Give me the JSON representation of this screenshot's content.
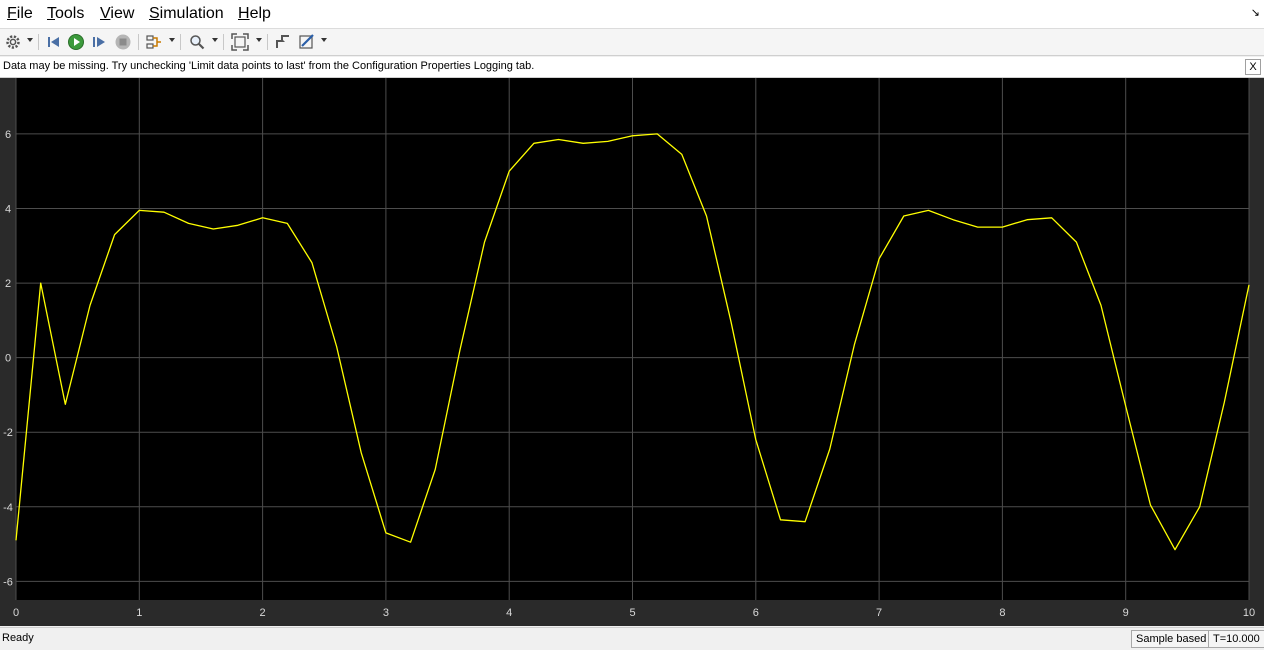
{
  "menu": {
    "items": [
      {
        "underline": "F",
        "rest": "ile"
      },
      {
        "underline": "T",
        "rest": "ools"
      },
      {
        "underline": "V",
        "rest": "iew"
      },
      {
        "underline": "S",
        "rest": "imulation"
      },
      {
        "underline": "H",
        "rest": "elp"
      }
    ],
    "corner_glyph": "↘"
  },
  "toolbar": {
    "icons": [
      "gear-icon",
      "step-back-icon",
      "run-icon",
      "step-forward-icon",
      "stop-icon",
      "signal-selector-icon",
      "zoom-icon",
      "fit-to-view-icon",
      "triggers-icon",
      "style-icon"
    ]
  },
  "info_bar": {
    "message": "Data may be missing.  Try unchecking 'Limit data points to last' from the Configuration Properties Logging tab.",
    "close_label": "X"
  },
  "status": {
    "ready": "Ready",
    "sample_mode": "Sample based",
    "time": "T=10.000"
  },
  "colors": {
    "plot_background": "#000000",
    "axes_background": "#2a2a2a",
    "trace": "#ffff00",
    "grid": "#4d4d4d",
    "tick_text": "#d9d9d9"
  },
  "chart_data": {
    "type": "line",
    "xlim": [
      0,
      10
    ],
    "ylim": [
      -6.5,
      7.5
    ],
    "xticks": [
      0,
      1,
      2,
      3,
      4,
      5,
      6,
      7,
      8,
      9,
      10
    ],
    "yticks": [
      -6,
      -4,
      -2,
      0,
      2,
      4,
      6
    ],
    "grid": true,
    "series": [
      {
        "x": [
          0,
          0.2,
          0.4,
          0.6,
          0.8,
          1.0,
          1.2,
          1.4,
          1.6,
          1.8,
          2.0,
          2.2,
          2.4,
          2.6,
          2.8,
          3.0,
          3.2,
          3.4,
          3.6,
          3.8,
          4.0,
          4.2,
          4.4,
          4.6,
          4.8,
          5.0,
          5.2,
          5.4,
          5.6,
          5.8,
          6.0,
          6.2,
          6.4,
          6.6,
          6.8,
          7.0,
          7.2,
          7.4,
          7.6,
          7.8,
          8.0,
          8.2,
          8.4,
          8.6,
          8.8,
          9.0,
          9.2,
          9.4,
          9.6,
          9.8,
          10.0
        ],
        "y": [
          -4.9,
          2.0,
          -1.25,
          1.4,
          3.3,
          3.95,
          3.9,
          3.6,
          3.45,
          3.55,
          3.75,
          3.6,
          2.55,
          0.3,
          -2.55,
          -4.7,
          -4.95,
          -3.0,
          0.2,
          3.1,
          5.0,
          5.75,
          5.85,
          5.75,
          5.8,
          5.95,
          6.0,
          5.45,
          3.8,
          0.95,
          -2.2,
          -4.35,
          -4.4,
          -2.45,
          0.35,
          2.65,
          3.8,
          3.95,
          3.7,
          3.5,
          3.5,
          3.7,
          3.75,
          3.1,
          1.4,
          -1.3,
          -3.95,
          -5.15,
          -4.0,
          -1.2,
          1.95
        ]
      }
    ]
  }
}
